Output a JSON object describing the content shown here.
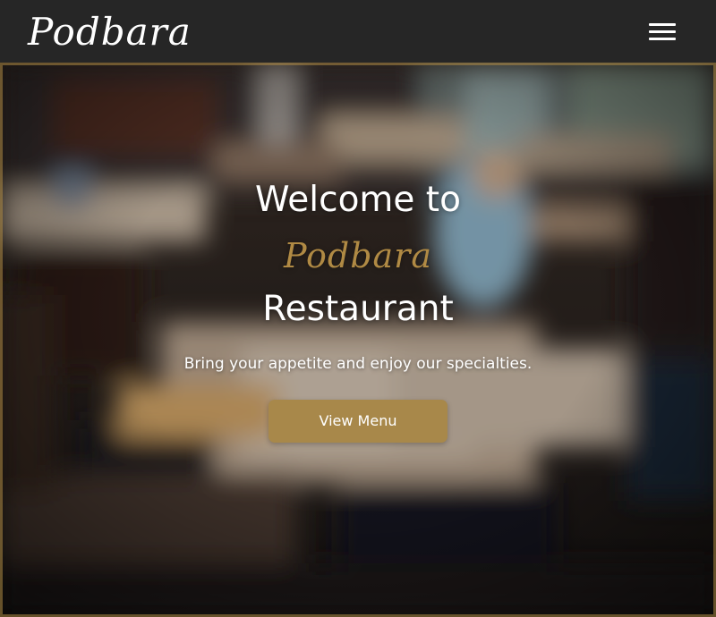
{
  "navbar": {
    "brand": "Podbara",
    "menu_icon": "hamburger-menu-icon"
  },
  "hero": {
    "background": "blurred-restaurant-interior-photo",
    "line1": "Welcome to",
    "line2": "Podbara",
    "line3": "Restaurant",
    "tagline": "Bring your appetite and enjoy our specialties.",
    "cta_label": "View Menu"
  },
  "colors": {
    "navbar_bg": "#262626",
    "accent_gold": "#b08a44",
    "button_bg": "#a8884a",
    "text_white": "#ffffff"
  }
}
